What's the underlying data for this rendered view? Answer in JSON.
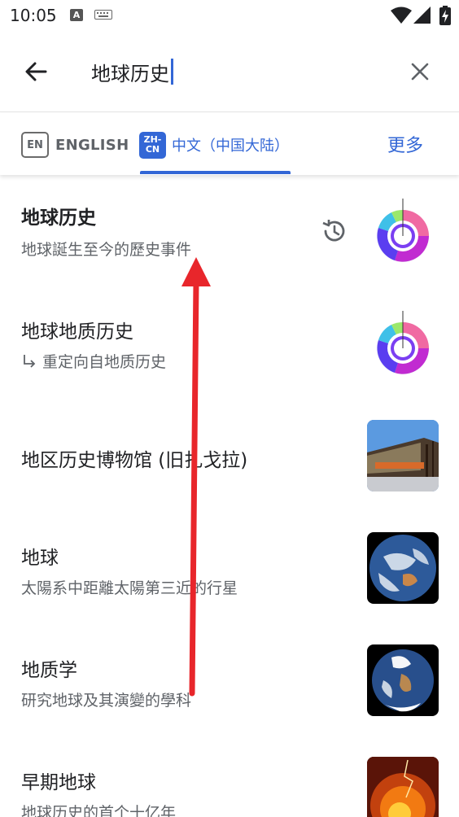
{
  "status_bar": {
    "time": "10:05",
    "badge": "A"
  },
  "search": {
    "query": "地球历史"
  },
  "tabs": {
    "en_badge": "EN",
    "en_label": "ENGLISH",
    "zh_badge_line1": "ZH-",
    "zh_badge_line2": "CN",
    "zh_label": "中文（中国大陆）",
    "more": "更多"
  },
  "results": [
    {
      "title": "地球历史",
      "description": "地球誕生至今的歷史事件",
      "icon": "history-icon",
      "thumbnail": "geologic-clock"
    },
    {
      "title": "地球地质历史",
      "redirect": "重定向自地质历史",
      "thumbnail": "geologic-clock"
    },
    {
      "title": "地区历史博物馆 (旧扎戈拉)",
      "thumbnail": "museum-building"
    },
    {
      "title": "地球",
      "description": "太陽系中距離太陽第三近的行星",
      "thumbnail": "earth-globe"
    },
    {
      "title": "地质学",
      "description": "研究地球及其演變的學科",
      "thumbnail": "earth-globe"
    },
    {
      "title": "早期地球",
      "description": "地球历史的首个十亿年",
      "thumbnail": "molten-earth"
    }
  ],
  "colors": {
    "accent": "#3367d6",
    "annotation_arrow": "#e8262b"
  }
}
